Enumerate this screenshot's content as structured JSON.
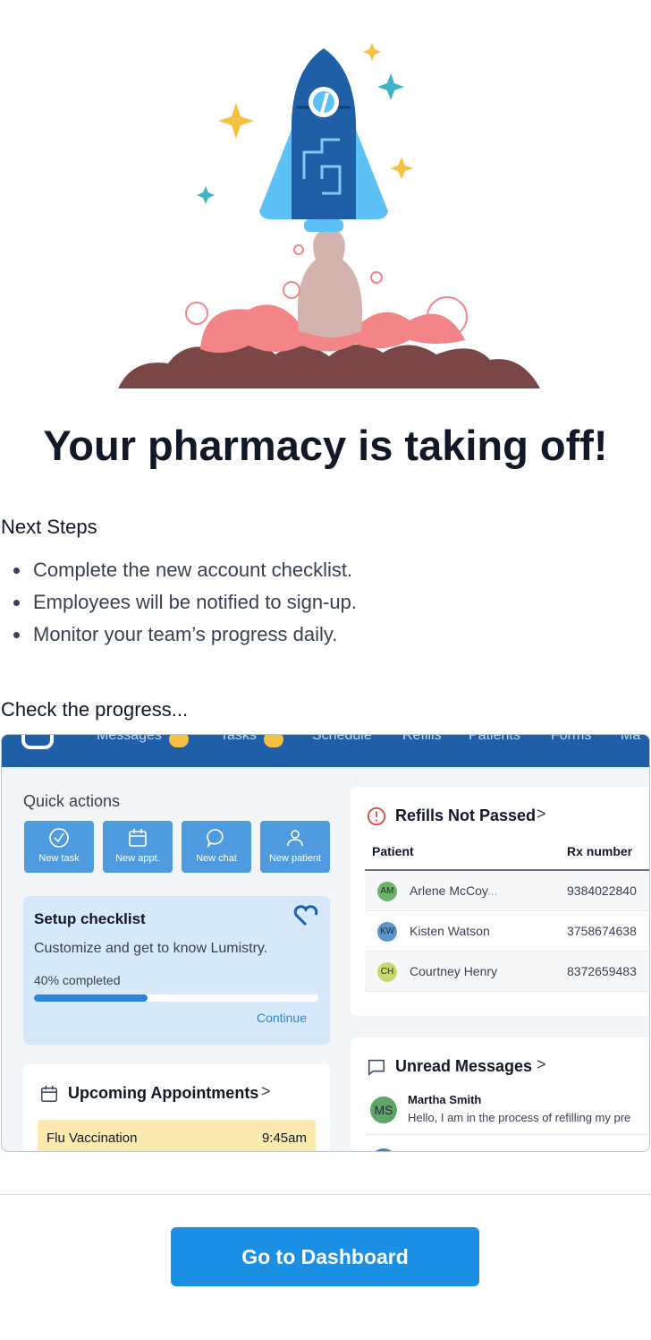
{
  "headline": "Your pharmacy is taking off!",
  "next_steps": {
    "title": "Next Steps",
    "items": [
      "Complete the new account checklist.",
      "Employees will be notified to sign-up.",
      "Monitor your team’s progress daily."
    ]
  },
  "progress_title": "Check the progress...",
  "preview": {
    "nav": [
      "Messages",
      "Tasks",
      "Schedule",
      "Refills",
      "Patients",
      "Forms",
      "Ma"
    ],
    "quick_actions": {
      "title": "Quick actions",
      "buttons": [
        {
          "label": "New task",
          "icon": "check-circle-icon"
        },
        {
          "label": "New appt.",
          "icon": "calendar-icon"
        },
        {
          "label": "New chat",
          "icon": "chat-bubble-icon"
        },
        {
          "label": "New patient",
          "icon": "user-icon"
        }
      ]
    },
    "checklist": {
      "title": "Setup checklist",
      "description": "Customize and get to know Lumistry.",
      "progress_label": "40% completed",
      "progress": 0.4,
      "continue_label": "Continue",
      "icon": "heart-icon"
    },
    "appointments": {
      "title": "Upcoming Appointments",
      "chevron": ">",
      "rows": [
        {
          "name": "Flu Vaccination",
          "time": "9:45am"
        }
      ]
    },
    "refills": {
      "title": "Refills Not Passed",
      "chevron": ">",
      "columns": [
        "Patient",
        "Rx number"
      ],
      "rows": [
        {
          "initials": "AM",
          "name": "Arlene McCoy",
          "suffix": "...",
          "rx": "9384022840",
          "color": "#6fb36a"
        },
        {
          "initials": "KW",
          "name": "Kisten Watson",
          "rx": "3758674638",
          "color": "#5b95cf"
        },
        {
          "initials": "CH",
          "name": "Courtney Henry",
          "rx": "8372659483",
          "color": "#c8d86a"
        }
      ]
    },
    "messages": {
      "title": "Unread Messages",
      "chevron": ">",
      "items": [
        {
          "initials": "MS",
          "from": "Martha Smith",
          "body": "Hello, I am in the process of refilling my pre"
        }
      ]
    }
  },
  "cta_label": "Go to Dashboard",
  "colors": {
    "primary": "#1a8fe3",
    "topbar": "#1f5fa8",
    "quick_action": "#4e9be0",
    "checklist_bg": "#d6e9fb",
    "appointment_bg": "#fbe9b0"
  }
}
